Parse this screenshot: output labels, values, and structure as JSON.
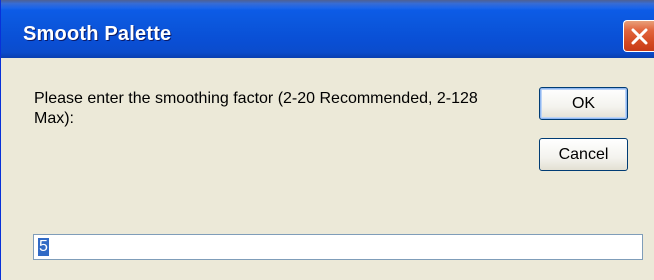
{
  "window": {
    "title": "Smooth Palette",
    "close_icon": "close-icon"
  },
  "dialog": {
    "message": "Please enter the smoothing factor (2-20 Recommended, 2-128 Max):",
    "ok_label": "OK",
    "cancel_label": "Cancel",
    "input_value": "5"
  },
  "colors": {
    "titlebar": "#0b57dd",
    "close_button": "#d44a22",
    "dialog_background": "#ece9d8",
    "selection": "#316ac5"
  }
}
